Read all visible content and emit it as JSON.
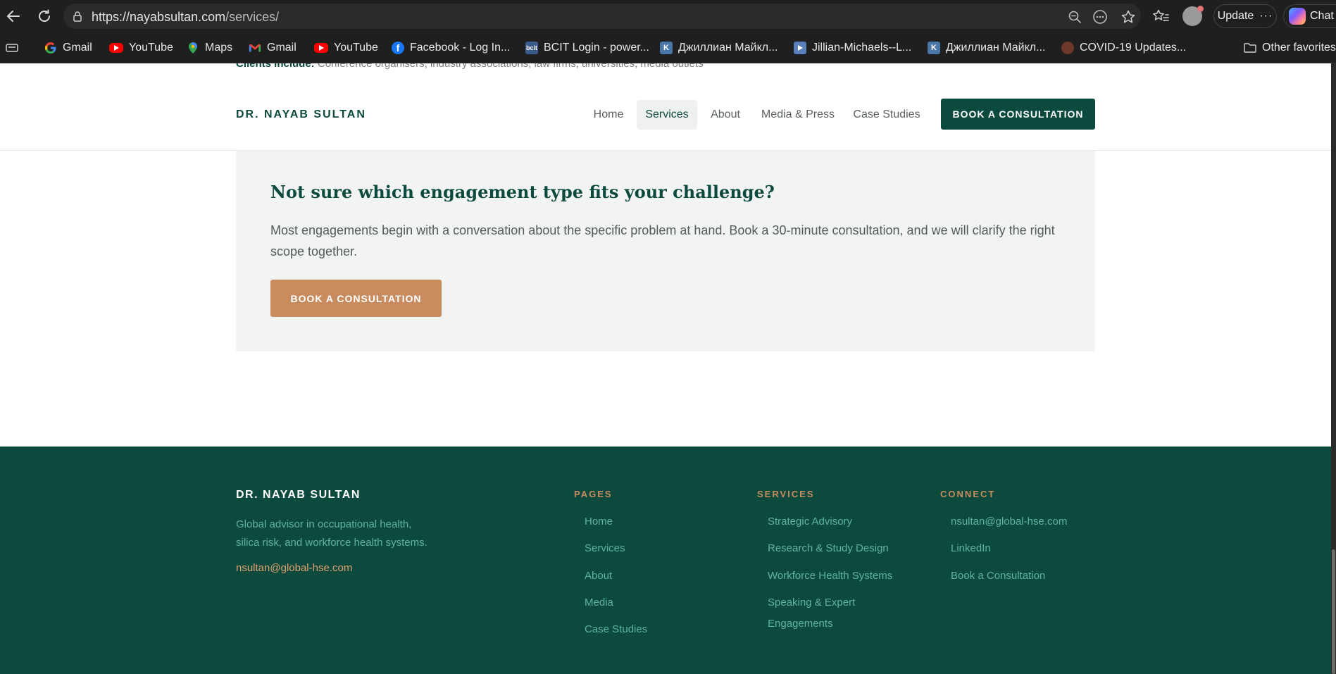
{
  "browser": {
    "url_host": "https://nayabsultan.com",
    "url_path": "/services/",
    "update_label": "Update",
    "chat_label": "Chat"
  },
  "bookmarks": [
    {
      "label": "Gmail",
      "icon": "google-icon"
    },
    {
      "label": "YouTube",
      "icon": "youtube-icon"
    },
    {
      "label": "Maps",
      "icon": "maps-icon"
    },
    {
      "label": "Gmail",
      "icon": "gmail-icon"
    },
    {
      "label": "YouTube",
      "icon": "youtube-icon"
    },
    {
      "label": "Facebook - Log In...",
      "icon": "facebook-icon"
    },
    {
      "label": "BCIT Login - power...",
      "icon": "bcit-icon"
    },
    {
      "label": "Джиллиан Майкл...",
      "icon": "vk-icon"
    },
    {
      "label": "Jillian-Michaels--L...",
      "icon": "video-icon"
    },
    {
      "label": "Джиллиан Майкл...",
      "icon": "vk-icon"
    },
    {
      "label": "COVID-19 Updates...",
      "icon": "covid-icon"
    }
  ],
  "other_favorites": "Other favorites",
  "page": {
    "peek_label": "Clients include:",
    "peek_text": "Conference organisers, industry associations, law firms, universities, media outlets",
    "header": {
      "brand": "DR. NAYAB SULTAN",
      "nav": [
        "Home",
        "Services",
        "About",
        "Media & Press",
        "Case Studies"
      ],
      "active": "Services",
      "cta": "BOOK A CONSULTATION"
    },
    "consult": {
      "title": "Not sure which engagement type fits your challenge?",
      "text": "Most engagements begin with a conversation about the specific problem at hand. Book a 30-minute consultation, and we will clarify the right scope together.",
      "cta": "BOOK A CONSULTATION"
    },
    "footer": {
      "brand": "DR. NAYAB SULTAN",
      "desc_line1": "Global advisor in occupational health,",
      "desc_line2": "silica risk, and workforce health systems.",
      "email": "nsultan@global-hse.com",
      "pages_heading": "PAGES",
      "pages": [
        "Home",
        "Services",
        "About",
        "Media",
        "Case Studies"
      ],
      "services_heading": "SERVICES",
      "services": [
        "Strategic Advisory",
        "Research & Study Design",
        "Workforce Health Systems",
        "Speaking & Expert",
        "Engagements"
      ],
      "connect_heading": "CONNECT",
      "connect": [
        "nsultan@global-hse.com",
        "LinkedIn",
        "Book a Consultation"
      ]
    }
  },
  "colors": {
    "brand_green": "#0d4a3e",
    "accent_copper": "#c98c5f",
    "footer_link": "#5fb3a2"
  }
}
